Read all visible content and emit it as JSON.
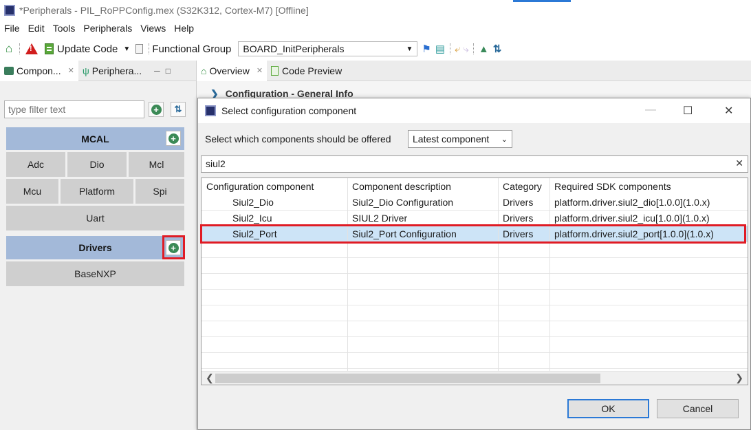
{
  "window": {
    "title": "*Peripherals - PIL_RoPPConfig.mex (S32K312, Cortex-M7) [Offline]",
    "icon": "chip-icon"
  },
  "menu": [
    "File",
    "Edit",
    "Tools",
    "Peripherals",
    "Views",
    "Help"
  ],
  "toolbar": {
    "update_code": "Update Code",
    "functional_group_label": "Functional Group",
    "functional_group_value": "BOARD_InitPeripherals"
  },
  "left_panel": {
    "tabs": [
      {
        "label": "Compon...",
        "close": "✕"
      },
      {
        "label": "Periphera..."
      }
    ],
    "filter_placeholder": "type filter text",
    "groups": [
      {
        "name": "MCAL",
        "items": [
          "Adc",
          "Dio",
          "Mcl",
          "Mcu",
          "Platform",
          "Spi",
          "Uart"
        ]
      },
      {
        "name": "Drivers",
        "items": [
          "BaseNXP"
        ]
      }
    ]
  },
  "editor": {
    "tabs": [
      {
        "label": "Overview",
        "close": "✕"
      },
      {
        "label": "Code Preview"
      }
    ],
    "section": "Configuration - General Info"
  },
  "dialog": {
    "title": "Select configuration component",
    "offered_label": "Select which components should be offered",
    "offered_value": "Latest component",
    "search_value": "siul2",
    "columns": [
      "Configuration component",
      "Component description",
      "Category",
      "Required SDK components"
    ],
    "rows": [
      {
        "component": "Siul2_Dio",
        "description": "Siul2_Dio Configuration",
        "category": "Drivers",
        "sdk": "platform.driver.siul2_dio[1.0.0](1.0.x)",
        "selected": false
      },
      {
        "component": "Siul2_Icu",
        "description": "SIUL2 Driver",
        "category": "Drivers",
        "sdk": "platform.driver.siul2_icu[1.0.0](1.0.x)",
        "selected": false
      },
      {
        "component": "Siul2_Port",
        "description": "Siul2_Port Configuration",
        "category": "Drivers",
        "sdk": "platform.driver.siul2_port[1.0.0](1.0.x)",
        "selected": true
      }
    ],
    "ok_label": "OK",
    "cancel_label": "Cancel"
  },
  "colors": {
    "group_header": "#a3b9d9",
    "component_button": "#cfcfcf",
    "selection": "#cde4f7",
    "highlight": "#e01b24",
    "accent": "#2b79d6"
  }
}
